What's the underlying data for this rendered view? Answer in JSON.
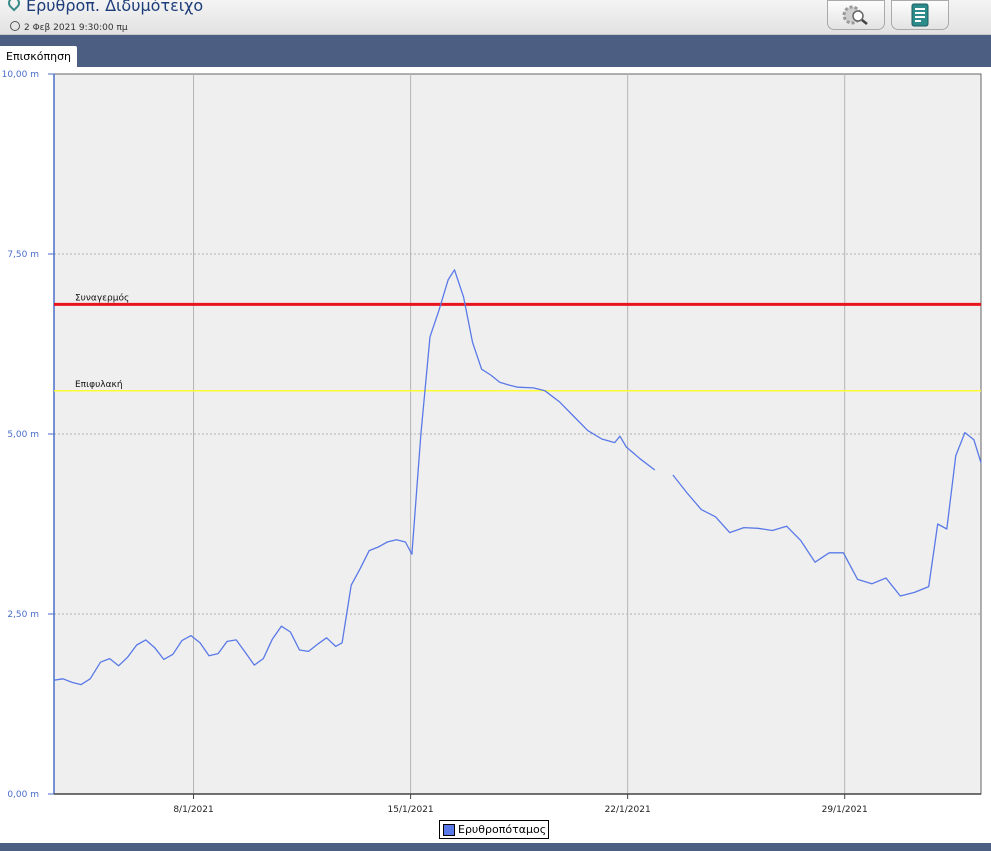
{
  "header": {
    "title": "Ερυθροπ. Διδυμότειχο",
    "timestamp": "2 Φεβ 2021 9:30:00 πμ",
    "buttons": [
      {
        "name": "zoom-search-button",
        "icon": "magnifier-icon"
      },
      {
        "name": "report-button",
        "icon": "document-list-icon"
      }
    ]
  },
  "tabs": [
    {
      "label": "Επισκόπηση",
      "active": true
    }
  ],
  "colors": {
    "series": "#5a79e8",
    "alarm": "#e8141e",
    "warning": "#ffff33",
    "tabbar": "#4c5e82",
    "plot_bg": "#efefef",
    "axis": "#4a6ec8"
  },
  "chart_data": {
    "type": "line",
    "y_unit": "m",
    "ylim": [
      0,
      10
    ],
    "y_ticks": [
      {
        "value": 0,
        "label": "0,00 m"
      },
      {
        "value": 2.5,
        "label": "2,50 m"
      },
      {
        "value": 5,
        "label": "5,00 m"
      },
      {
        "value": 7.5,
        "label": "7,50 m"
      },
      {
        "value": 10,
        "label": "10,00 m"
      }
    ],
    "x_range": [
      "2021-01-03T12:00",
      "2021-02-02T09:30"
    ],
    "x_ticks": [
      {
        "date": "2021-01-08",
        "label": "8/1/2021"
      },
      {
        "date": "2021-01-15",
        "label": "15/1/2021"
      },
      {
        "date": "2021-01-22",
        "label": "22/1/2021"
      },
      {
        "date": "2021-01-29",
        "label": "29/1/2021"
      }
    ],
    "thresholds": [
      {
        "label": "Συναγερμός",
        "value": 6.8,
        "color": "#e8141e"
      },
      {
        "label": "Επιφυλακή",
        "value": 5.6,
        "color": "#ffff33"
      }
    ],
    "legend": "bottom",
    "series": [
      {
        "name": "Ερυθροπόταμος",
        "color": "#5a79e8",
        "segments": [
          [
            [
              "2021-01-03T12:00",
              1.58
            ],
            [
              "2021-01-03T19:00",
              1.6
            ],
            [
              "2021-01-04T02:00",
              1.55
            ],
            [
              "2021-01-04T09:00",
              1.52
            ],
            [
              "2021-01-04T16:00",
              1.6
            ],
            [
              "2021-01-05T00:00",
              1.83
            ],
            [
              "2021-01-05T07:00",
              1.88
            ],
            [
              "2021-01-05T14:00",
              1.78
            ],
            [
              "2021-01-05T21:00",
              1.9
            ],
            [
              "2021-01-06T04:00",
              2.07
            ],
            [
              "2021-01-06T11:00",
              2.14
            ],
            [
              "2021-01-06T18:00",
              2.03
            ],
            [
              "2021-01-07T01:00",
              1.87
            ],
            [
              "2021-01-07T08:00",
              1.94
            ],
            [
              "2021-01-07T15:00",
              2.13
            ],
            [
              "2021-01-07T22:00",
              2.2
            ],
            [
              "2021-01-08T05:00",
              2.1
            ],
            [
              "2021-01-08T12:00",
              1.92
            ],
            [
              "2021-01-08T19:00",
              1.95
            ],
            [
              "2021-01-09T02:00",
              2.12
            ],
            [
              "2021-01-09T09:00",
              2.14
            ],
            [
              "2021-01-09T16:00",
              1.97
            ],
            [
              "2021-01-09T23:00",
              1.79
            ],
            [
              "2021-01-10T06:00",
              1.88
            ],
            [
              "2021-01-10T13:00",
              2.15
            ],
            [
              "2021-01-10T20:00",
              2.33
            ],
            [
              "2021-01-11T03:00",
              2.25
            ],
            [
              "2021-01-11T10:00",
              2.0
            ],
            [
              "2021-01-11T17:00",
              1.98
            ],
            [
              "2021-01-12T00:00",
              2.08
            ],
            [
              "2021-01-12T07:00",
              2.17
            ],
            [
              "2021-01-12T14:00",
              2.05
            ],
            [
              "2021-01-12T19:00",
              2.1
            ],
            [
              "2021-01-13T02:00",
              2.9
            ],
            [
              "2021-01-13T09:00",
              3.13
            ],
            [
              "2021-01-13T16:00",
              3.38
            ],
            [
              "2021-01-13T23:00",
              3.43
            ],
            [
              "2021-01-14T06:00",
              3.5
            ],
            [
              "2021-01-14T13:00",
              3.53
            ],
            [
              "2021-01-14T20:00",
              3.5
            ],
            [
              "2021-01-15T01:00",
              3.33
            ],
            [
              "2021-01-15T08:00",
              5.0
            ],
            [
              "2021-01-15T15:00",
              6.35
            ],
            [
              "2021-01-15T22:00",
              6.72
            ],
            [
              "2021-01-16T05:00",
              7.14
            ],
            [
              "2021-01-16T10:00",
              7.28
            ],
            [
              "2021-01-16T17:00",
              6.9
            ],
            [
              "2021-01-17T00:00",
              6.27
            ],
            [
              "2021-01-17T07:00",
              5.9
            ],
            [
              "2021-01-17T14:00",
              5.82
            ],
            [
              "2021-01-17T21:00",
              5.72
            ],
            [
              "2021-01-18T04:00",
              5.68
            ],
            [
              "2021-01-18T11:00",
              5.65
            ],
            [
              "2021-01-18T23:00",
              5.64
            ],
            [
              "2021-01-19T08:00",
              5.6
            ],
            [
              "2021-01-19T19:00",
              5.45
            ],
            [
              "2021-01-20T06:00",
              5.25
            ],
            [
              "2021-01-20T17:00",
              5.05
            ],
            [
              "2021-01-21T04:00",
              4.93
            ],
            [
              "2021-01-21T14:00",
              4.88
            ],
            [
              "2021-01-21T18:00",
              4.97
            ],
            [
              "2021-01-21T23:00",
              4.82
            ],
            [
              "2021-01-22T10:00",
              4.65
            ],
            [
              "2021-01-22T21:00",
              4.5
            ]
          ],
          [
            [
              "2021-01-23T11:00",
              4.43
            ],
            [
              "2021-01-23T22:00",
              4.18
            ],
            [
              "2021-01-24T09:00",
              3.95
            ],
            [
              "2021-01-24T20:00",
              3.85
            ],
            [
              "2021-01-25T07:00",
              3.63
            ],
            [
              "2021-01-25T18:00",
              3.7
            ],
            [
              "2021-01-26T05:00",
              3.69
            ],
            [
              "2021-01-26T16:00",
              3.66
            ],
            [
              "2021-01-27T03:00",
              3.72
            ],
            [
              "2021-01-27T14:00",
              3.52
            ],
            [
              "2021-01-28T01:00",
              3.22
            ],
            [
              "2021-01-28T12:00",
              3.35
            ],
            [
              "2021-01-28T23:00",
              3.35
            ],
            [
              "2021-01-29T10:00",
              2.98
            ],
            [
              "2021-01-29T21:00",
              2.92
            ],
            [
              "2021-01-30T08:00",
              3.0
            ],
            [
              "2021-01-30T19:00",
              2.75
            ],
            [
              "2021-01-31T06:00",
              2.8
            ],
            [
              "2021-01-31T17:00",
              2.88
            ],
            [
              "2021-02-01T00:00",
              3.75
            ],
            [
              "2021-02-01T07:00",
              3.68
            ],
            [
              "2021-02-01T14:00",
              4.7
            ],
            [
              "2021-02-01T21:00",
              5.02
            ],
            [
              "2021-02-02T04:00",
              4.92
            ],
            [
              "2021-02-02T09:30",
              4.6
            ]
          ]
        ]
      }
    ]
  }
}
